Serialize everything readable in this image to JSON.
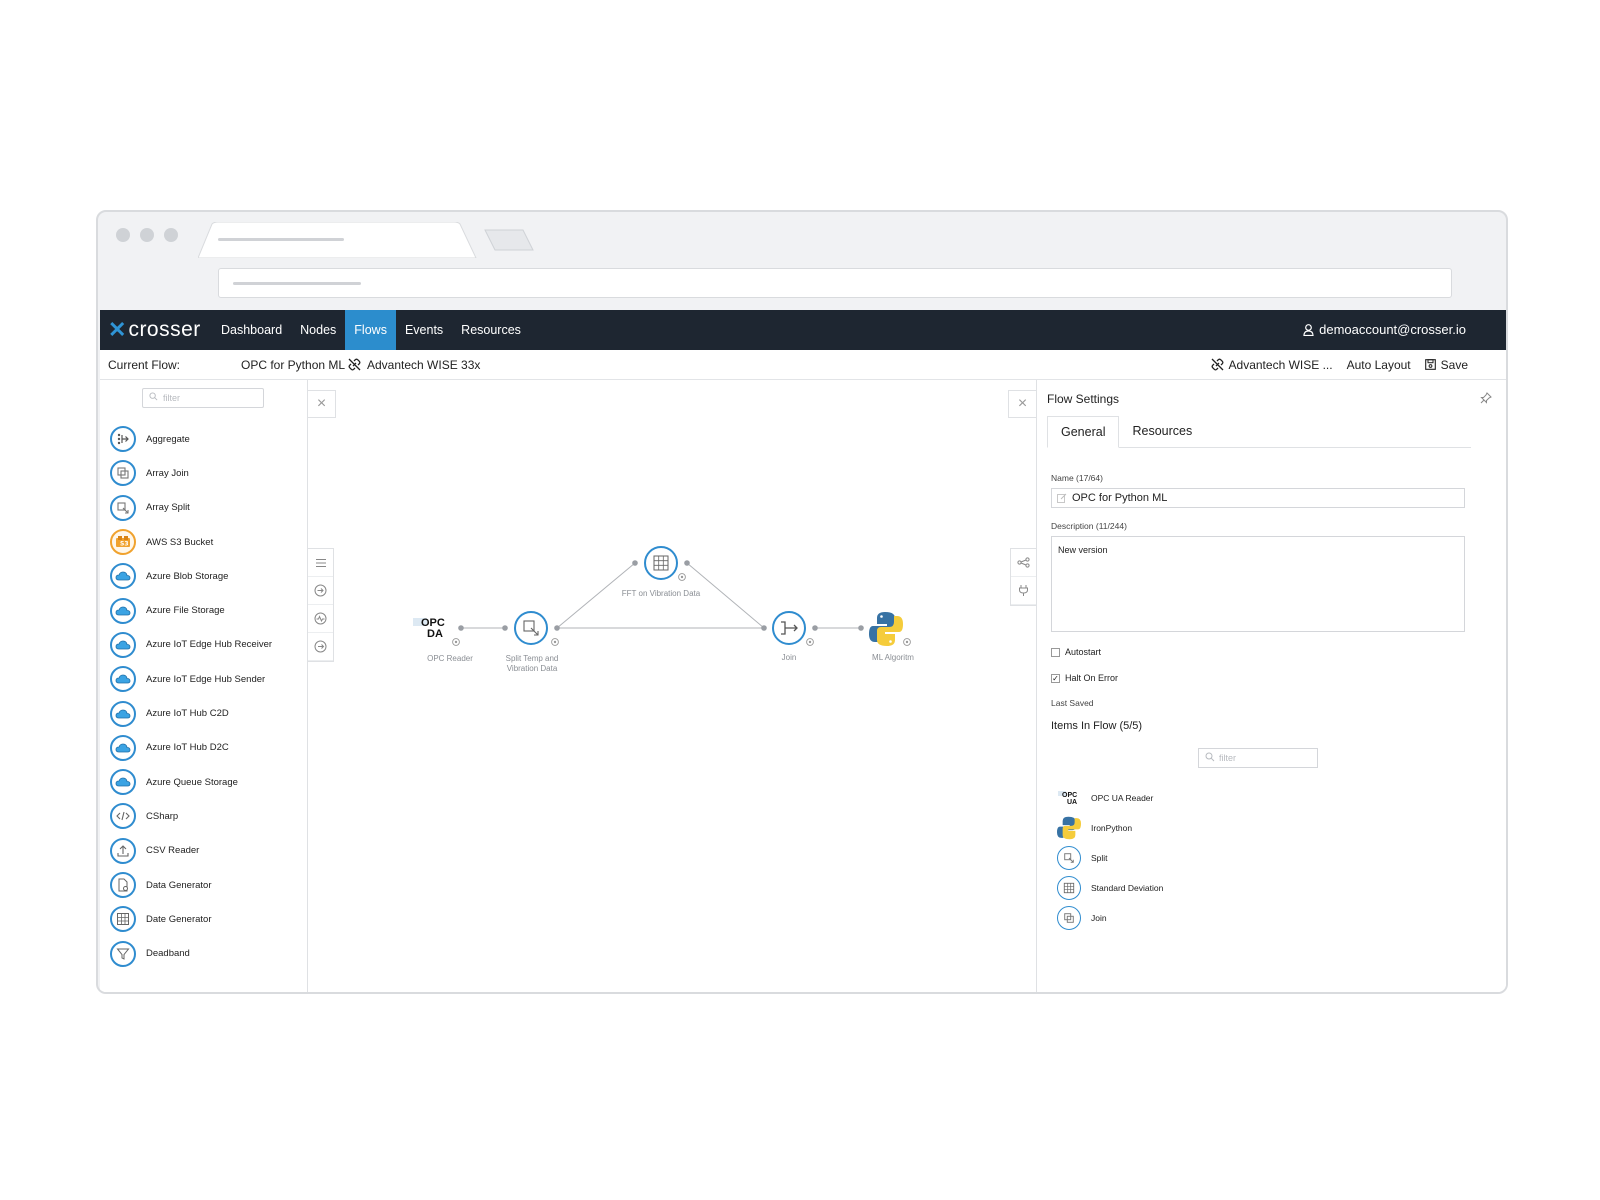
{
  "nav": {
    "logo": "crosser",
    "items": [
      {
        "label": "Dashboard",
        "active": false
      },
      {
        "label": "Nodes",
        "active": false
      },
      {
        "label": "Flows",
        "active": true
      },
      {
        "label": "Events",
        "active": false
      },
      {
        "label": "Resources",
        "active": false
      }
    ],
    "user": "demoaccount@crosser.io"
  },
  "toolbar": {
    "current_flow_label": "Current Flow:",
    "flow_name": "OPC for Python ML",
    "device": "Advantech WISE 33x",
    "device_short": "Advantech WISE ...",
    "auto_layout": "Auto Layout",
    "save": "Save"
  },
  "left_panel": {
    "filter_placeholder": "filter",
    "nodes": [
      {
        "label": "Aggregate",
        "icon": "aggregate-icon"
      },
      {
        "label": "Array Join",
        "icon": "array-join-icon"
      },
      {
        "label": "Array Split",
        "icon": "array-split-icon"
      },
      {
        "label": "AWS S3 Bucket",
        "icon": "aws-s3-icon"
      },
      {
        "label": "Azure Blob Storage",
        "icon": "azure-cloud-icon"
      },
      {
        "label": "Azure File Storage",
        "icon": "azure-cloud-icon"
      },
      {
        "label": "Azure IoT Edge Hub Receiver",
        "icon": "azure-cloud-icon"
      },
      {
        "label": "Azure IoT Edge Hub Sender",
        "icon": "azure-cloud-icon"
      },
      {
        "label": "Azure IoT Hub C2D",
        "icon": "azure-cloud-icon"
      },
      {
        "label": "Azure IoT Hub D2C",
        "icon": "azure-cloud-icon"
      },
      {
        "label": "Azure Queue Storage",
        "icon": "azure-cloud-icon"
      },
      {
        "label": "CSharp",
        "icon": "code-icon"
      },
      {
        "label": "CSV Reader",
        "icon": "upload-icon"
      },
      {
        "label": "Data Generator",
        "icon": "data-generator-icon"
      },
      {
        "label": "Date Generator",
        "icon": "grid-icon"
      },
      {
        "label": "Deadband",
        "icon": "filter-icon"
      }
    ]
  },
  "canvas": {
    "nodes": [
      {
        "label": "OPC Reader",
        "logo_text": "OPC DA"
      },
      {
        "label": "Split Temp and Vibration Data"
      },
      {
        "label": "FFT on Vibration Data"
      },
      {
        "label": "Join"
      },
      {
        "label": "ML Algoritm"
      }
    ]
  },
  "flow_settings": {
    "title": "Flow Settings",
    "tabs": [
      {
        "label": "General",
        "active": true
      },
      {
        "label": "Resources",
        "active": false
      }
    ],
    "name_label": "Name (17/64)",
    "name_value": "OPC for Python ML",
    "description_label": "Description (11/244)",
    "description_value": "New version",
    "autostart_label": "Autostart",
    "autostart_checked": false,
    "halt_label": "Halt On Error",
    "halt_checked": true,
    "last_saved_label": "Last Saved",
    "items_title": "Items In Flow (5/5)",
    "filter_placeholder": "filter",
    "items": [
      {
        "label": "OPC UA Reader",
        "icon": "opc-ua-logo-icon"
      },
      {
        "label": "IronPython",
        "icon": "python-icon"
      },
      {
        "label": "Split",
        "icon": "split-icon"
      },
      {
        "label": "Standard Deviation",
        "icon": "grid-icon"
      },
      {
        "label": "Join",
        "icon": "join-icon"
      }
    ]
  },
  "colors": {
    "nav_bg": "#1e2631",
    "accent": "#2c8dcd",
    "node_border": "#2f8ccf",
    "aws": "#f0a22e"
  }
}
